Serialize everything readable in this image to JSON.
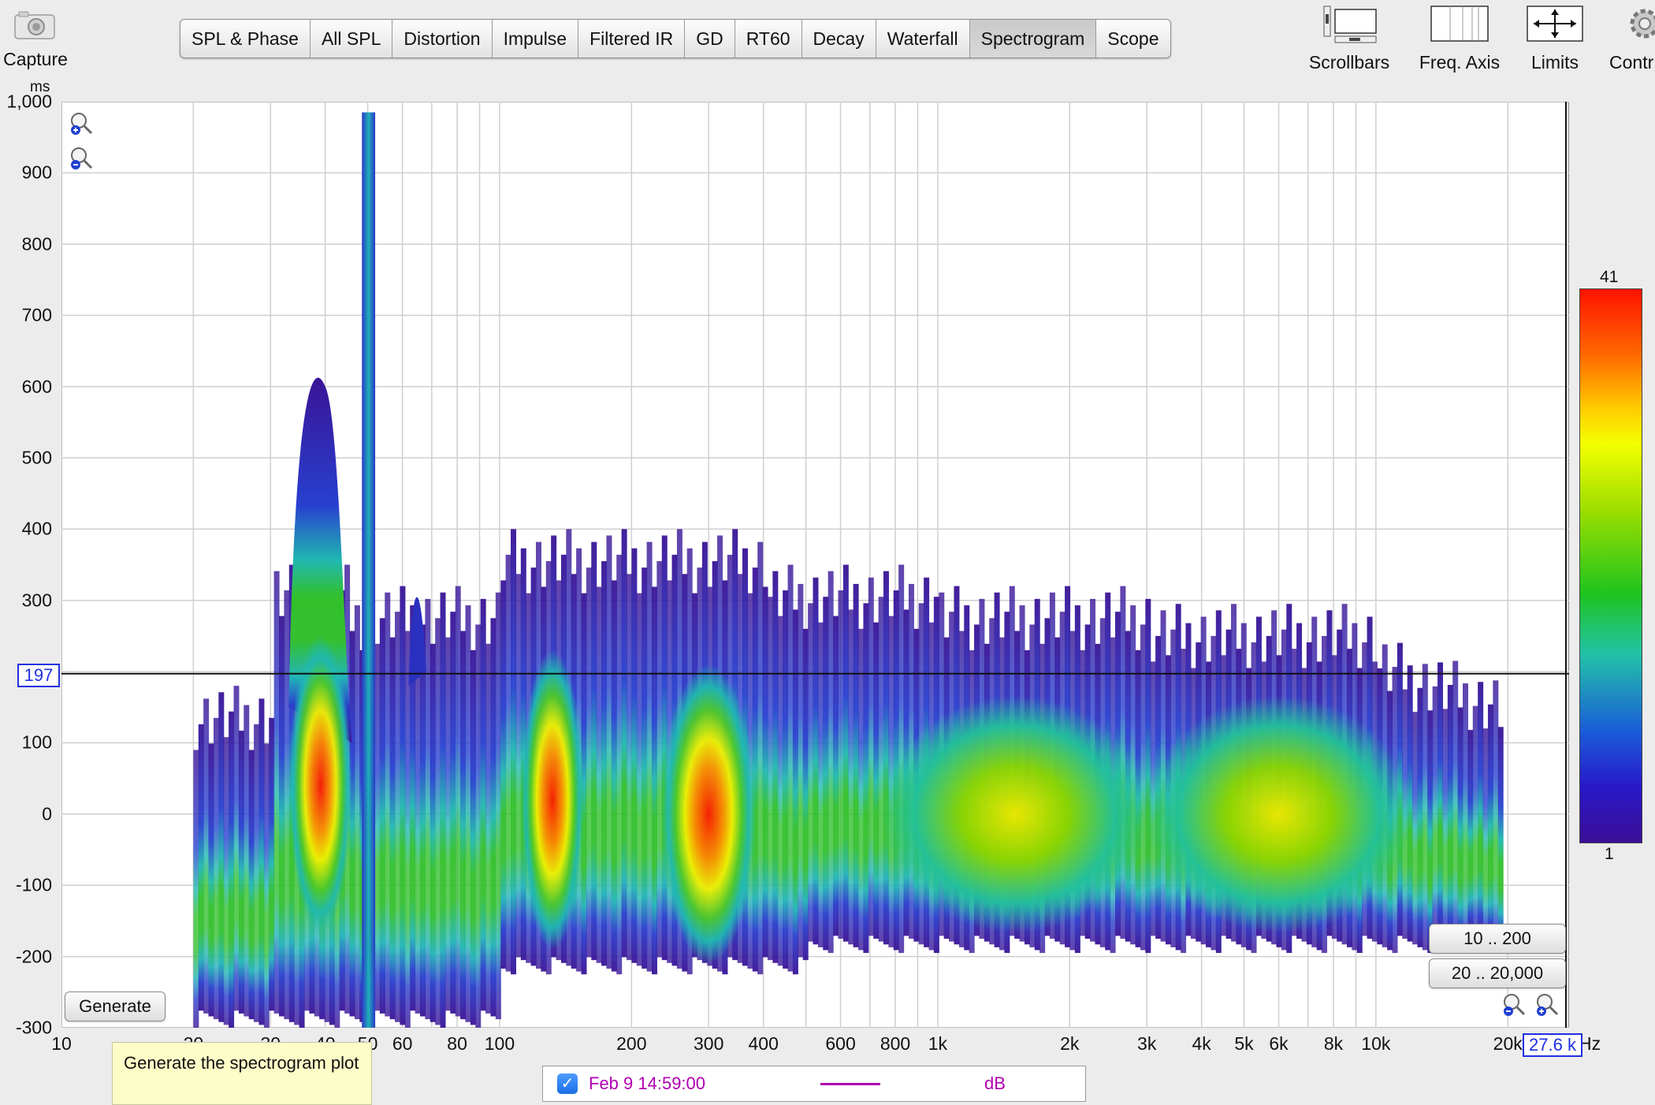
{
  "toolbar": {
    "capture_label": "Capture",
    "tabs": [
      "SPL & Phase",
      "All SPL",
      "Distortion",
      "Impulse",
      "Filtered IR",
      "GD",
      "RT60",
      "Decay",
      "Waterfall",
      "Spectrogram",
      "Scope"
    ],
    "active_tab": "Spectrogram",
    "scrollbars_label": "Scrollbars",
    "freq_axis_label": "Freq. Axis",
    "limits_label": "Limits",
    "controls_label": "Contr"
  },
  "plot": {
    "y_unit": "ms",
    "y_ticks": [
      "1,000",
      "900",
      "800",
      "700",
      "600",
      "500",
      "400",
      "300",
      "197",
      "100",
      "0",
      "-100",
      "-200",
      "-300"
    ],
    "x_unit": "Hz",
    "x_ticks": [
      "10",
      "20",
      "30",
      "40",
      "50",
      "60",
      "80",
      "100",
      "200",
      "300",
      "400",
      "600",
      "800",
      "1k",
      "2k",
      "3k",
      "4k",
      "5k",
      "6k",
      "8k",
      "10k",
      "20k"
    ],
    "cursor_y": "197",
    "cursor_x": "27.6 k"
  },
  "chart_data": {
    "type": "heatmap",
    "xlabel": "Hz",
    "ylabel": "ms",
    "xscale": "log",
    "xlim": [
      10,
      27600
    ],
    "ylim": [
      -300,
      1000
    ],
    "color_scale": {
      "min": 1,
      "max": 41,
      "unit": "dB"
    },
    "cursor": {
      "x": 27600,
      "y": 197
    },
    "peaks": [
      {
        "freq_hz": 39,
        "time_ms": 40,
        "level": 41
      },
      {
        "freq_hz": 50,
        "time_ms": 980,
        "level": 20
      },
      {
        "freq_hz": 65,
        "time_ms": 340,
        "level": 14
      },
      {
        "freq_hz": 132,
        "time_ms": 20,
        "level": 40
      },
      {
        "freq_hz": 300,
        "time_ms": 0,
        "level": 34
      },
      {
        "freq_hz": 1500,
        "time_ms": 0,
        "level": 24
      },
      {
        "freq_hz": 6000,
        "time_ms": 0,
        "level": 22
      }
    ]
  },
  "colorbar": {
    "max": "41",
    "min": "1"
  },
  "buttons": {
    "generate": "Generate",
    "time_range": "10 .. 200",
    "freq_range": "20 .. 20,000"
  },
  "tooltip": "Generate the spectrogram plot",
  "legend": {
    "checked": true,
    "name": "Feb 9 14:59:00",
    "unit": "dB",
    "color": "#b000b0"
  }
}
